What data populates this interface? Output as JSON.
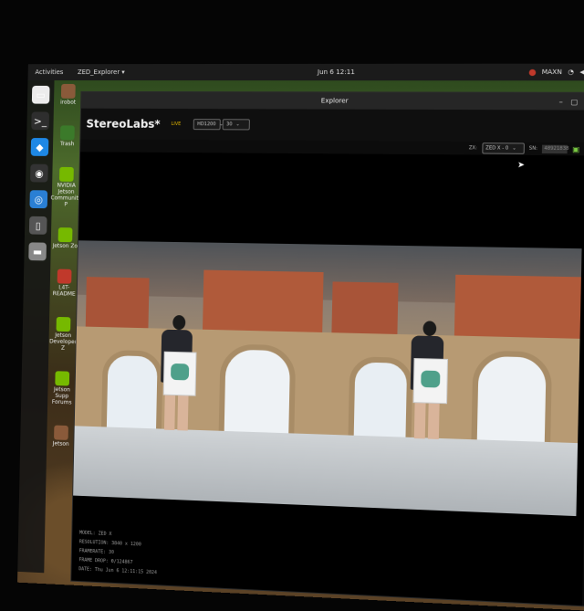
{
  "topbar": {
    "activities": "Activities",
    "app_menu": "ZED_Explorer ▾",
    "clock": "Jun 6 12:11",
    "user_badge": "MAXN",
    "wifi_icon": "wifi-icon",
    "volume_icon": "volume-icon",
    "power_icon": "power-icon"
  },
  "dock": {
    "apps": [
      {
        "name": "files",
        "glyph": "▭",
        "color": "#ececec"
      },
      {
        "name": "terminal",
        "glyph": ">_",
        "color": "#2e2e2e"
      },
      {
        "name": "vscode",
        "glyph": "◆",
        "color": "#1e88e5"
      },
      {
        "name": "obs",
        "glyph": "◉",
        "color": "#333"
      },
      {
        "name": "chromium",
        "glyph": "◎",
        "color": "#2a7fd4"
      },
      {
        "name": "app",
        "glyph": "▯",
        "color": "#555"
      },
      {
        "name": "drive",
        "glyph": "▬",
        "color": "#888"
      }
    ]
  },
  "desktop": {
    "icons": [
      {
        "label": "irobot",
        "color": "#8a5a3a"
      },
      {
        "label": "Trash",
        "color": "#3b7a2a"
      },
      {
        "label": "NVIDIA Jetson Community P",
        "color": "#76b900"
      },
      {
        "label": "Jetson Zo",
        "color": "#76b900"
      },
      {
        "label": "L4T-README",
        "color": "#c0392b"
      },
      {
        "label": "Jetson Developer Z",
        "color": "#76b900"
      },
      {
        "label": "Jetson Supp Forums",
        "color": "#76b900"
      },
      {
        "label": "Jetson",
        "color": "#8a5a3a"
      }
    ]
  },
  "window": {
    "title": "Explorer",
    "controls": {
      "minimize": "–",
      "maximize": "▢",
      "close": "✕"
    }
  },
  "toolbar": {
    "brand": "StereoLabs*",
    "live": "LIVE",
    "resolution": "HD1200",
    "fps": "30"
  },
  "subbar": {
    "camera_label": "ZX:",
    "camera_select": "ZED X - 0",
    "serial_label": "SN:",
    "serial_value": "48921838",
    "record_icon": "record-icon",
    "settings_icon": "gear-icon"
  },
  "info": {
    "model": "MODEL: ZED X",
    "resolution": "RESOLUTION: 3840 x 1200",
    "framerate": "FRAMERATE: 30",
    "frame_drop": "FRAME DROP: 0/124867",
    "date": "DATE: Thu Jun 6 12:11:15 2024"
  }
}
